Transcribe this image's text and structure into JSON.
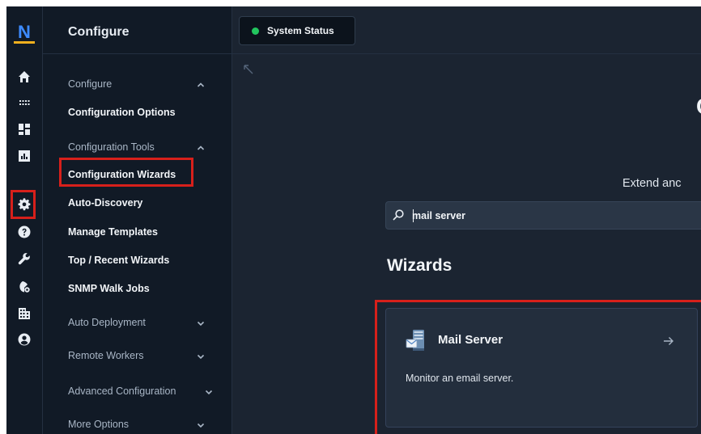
{
  "brand": {
    "logo_letter": "N",
    "accent": "#3d8bff",
    "logo_underline": "#f2b01e"
  },
  "highlight_color": "#d7201b",
  "sidebar": {
    "title": "Configure",
    "sections": [
      {
        "label": "Configure",
        "expanded": true,
        "items": [
          "Configuration Options"
        ]
      },
      {
        "label": "Configuration Tools",
        "expanded": true,
        "items": [
          "Configuration Wizards",
          "Auto-Discovery",
          "Manage Templates",
          "Top / Recent Wizards",
          "SNMP Walk Jobs"
        ]
      },
      {
        "label": "Auto Deployment",
        "expanded": false
      },
      {
        "label": "Remote Workers",
        "expanded": false
      },
      {
        "label": "Advanced Configuration",
        "expanded": false
      },
      {
        "label": "More Options",
        "expanded": false
      }
    ]
  },
  "rail_icons": [
    "home-icon",
    "apps-grid-icon",
    "dashboard-icon",
    "reports-icon",
    "settings-gear-icon",
    "help-icon",
    "wrench-icon",
    "incident-icon",
    "building-icon",
    "user-account-icon"
  ],
  "topbar": {
    "status_label": "System Status",
    "status_color": "#22c55e"
  },
  "main": {
    "title_partial": "C",
    "subtitle_partial": "Extend anc",
    "search": {
      "value": "mail server"
    },
    "section_title": "Wizards",
    "card": {
      "title": "Mail Server",
      "description": "Monitor an email server.",
      "icon": "mail-server-icon"
    }
  }
}
